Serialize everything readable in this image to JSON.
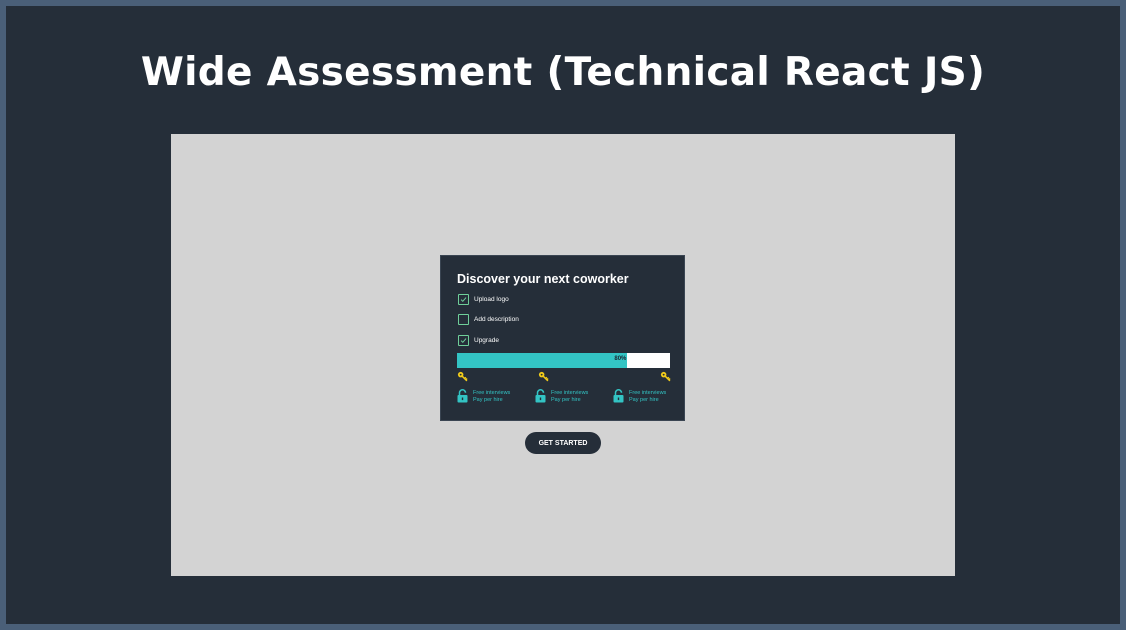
{
  "page": {
    "title": "Wide Assessment (Technical React JS)"
  },
  "card": {
    "title": "Discover your next coworker",
    "tasks": [
      {
        "label": "Upload logo",
        "checked": true
      },
      {
        "label": "Add description",
        "checked": false
      },
      {
        "label": "Upgrade",
        "checked": true
      }
    ],
    "progress": {
      "percent": 80,
      "label": "80%"
    },
    "milestones": [
      {
        "line1": "Free interviews",
        "line2": "Pay per hire"
      },
      {
        "line1": "Free interviews",
        "line2": "Pay per hire"
      },
      {
        "line1": "Free interviews",
        "line2": "Pay per hire"
      }
    ]
  },
  "cta": {
    "label": "GET STARTED"
  },
  "colors": {
    "background": "#252e39",
    "canvas": "#d3d3d3",
    "accent": "#33c4c4",
    "key": "#f2cc1a",
    "check": "#6fcf9a"
  },
  "icons": {
    "key": "key-icon",
    "lock": "unlocked-padlock-icon",
    "check": "checkmark-icon"
  }
}
